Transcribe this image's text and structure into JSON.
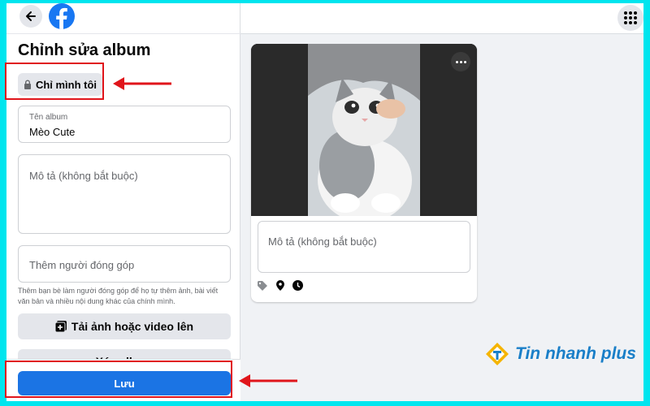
{
  "left_panel": {
    "title": "Chỉnh sửa album",
    "privacy_label": "Chỉ mình tôi",
    "album_name": {
      "label": "Tên album",
      "value": "Mèo Cute"
    },
    "description_placeholder": "Mô tả (không bắt buộc)",
    "contributors_placeholder": "Thêm người đóng góp",
    "helper_text": "Thêm bạn bè làm người đóng góp để họ tự thêm ảnh, bài viết văn bản và nhiều nội dung khác của chính mình.",
    "upload_label": "Tải ảnh hoặc video lên",
    "delete_label": "Xóa album",
    "save_label": "Lưu"
  },
  "photo_card": {
    "description_placeholder": "Mô tả (không bắt buộc)",
    "icons": [
      "tag-icon",
      "location-pin-icon",
      "clock-icon"
    ]
  },
  "watermark": {
    "text": "Tin nhanh plus"
  },
  "colors": {
    "background": "#00e5ee",
    "facebook_blue": "#1877f2",
    "save_button": "#1b74e4",
    "highlight": "#e0151b",
    "watermark": "#1a7fc8"
  }
}
